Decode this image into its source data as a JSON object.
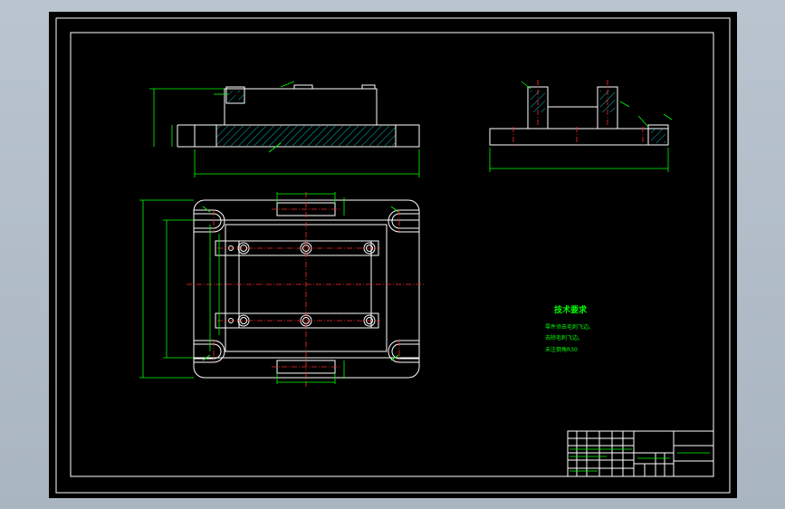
{
  "technical_requirements": {
    "title": "技术要求",
    "lines": [
      "零件须去毛刺飞边。",
      "去除毛刺飞边。",
      "未注倒角R30"
    ]
  },
  "colors": {
    "background": "#000000",
    "outline": "#ffffff",
    "dimension": "#00ff00",
    "centerline": "#ff2a2a",
    "hidden": "#00e5e5"
  }
}
